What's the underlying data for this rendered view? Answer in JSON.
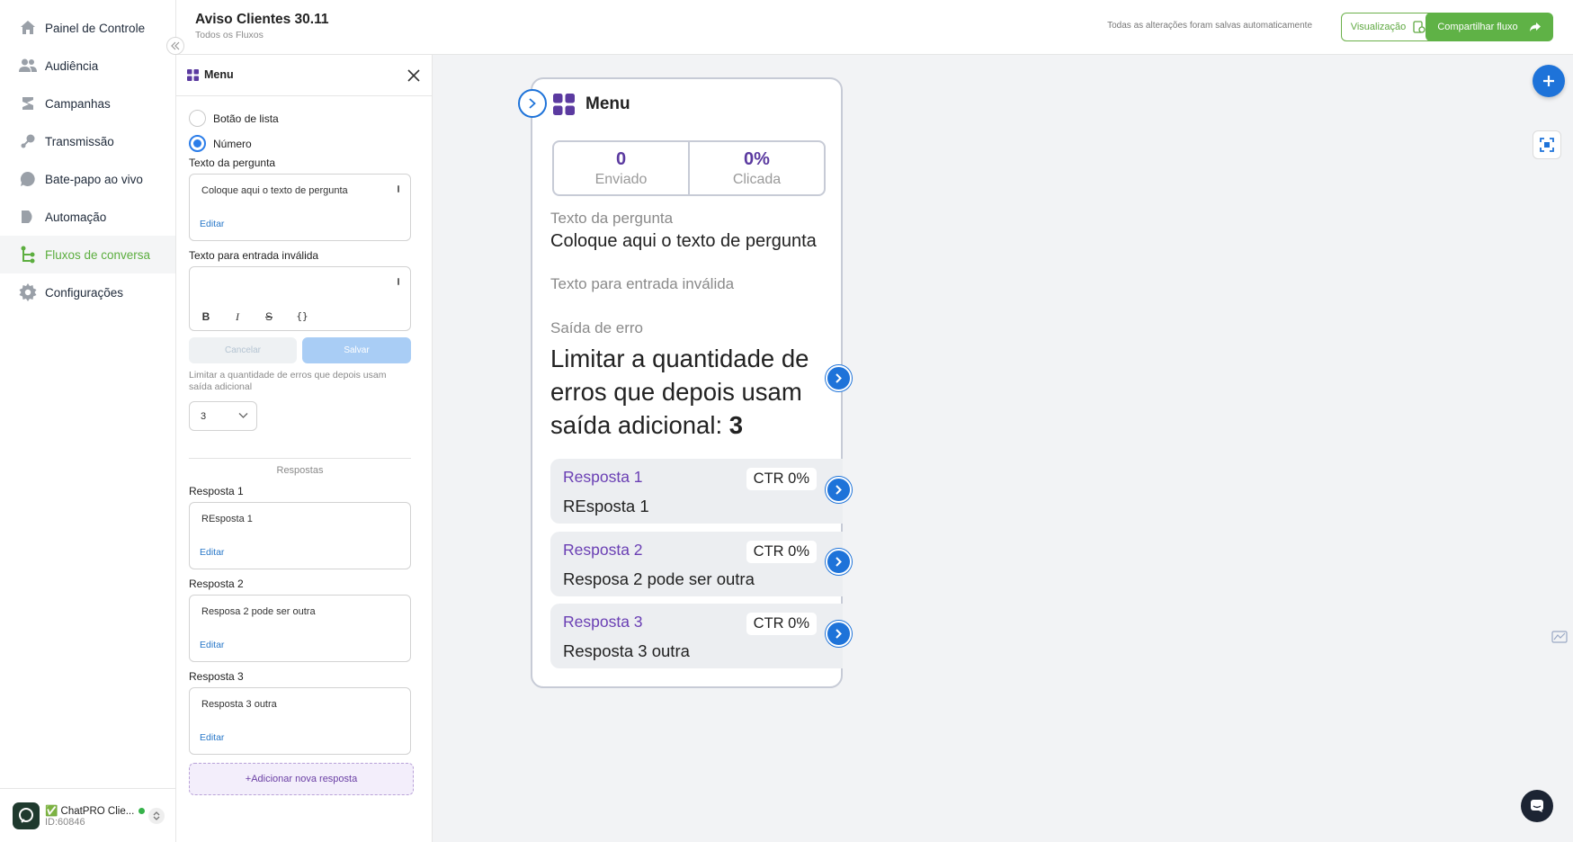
{
  "sidebar": {
    "items": [
      {
        "label": "Painel de Controle",
        "icon": "home-icon"
      },
      {
        "label": "Audiência",
        "icon": "users-icon"
      },
      {
        "label": "Campanhas",
        "icon": "campaign-icon"
      },
      {
        "label": "Transmissão",
        "icon": "broadcast-icon"
      },
      {
        "label": "Bate-papo ao vivo",
        "icon": "chat-bubble-icon"
      },
      {
        "label": "Automação",
        "icon": "automation-icon"
      },
      {
        "label": "Fluxos de conversa",
        "icon": "flow-icon"
      },
      {
        "label": "Configurações",
        "icon": "gear-icon"
      }
    ],
    "active_index": 6,
    "account": {
      "name": "✅ ChatPRO Clie...",
      "id": "ID:60846"
    }
  },
  "header": {
    "title": "Aviso Clientes 30.11",
    "breadcrumb": "Todos os Fluxos",
    "autosave": "Todas as alterações foram salvas automaticamente",
    "preview_label": "Visualização",
    "share_label": "Compartilhar fluxo"
  },
  "editor": {
    "title": "Menu",
    "radio_list_label": "Botão de lista",
    "radio_number_label": "Número",
    "question_label": "Texto da pergunta",
    "question_text": "Coloque aqui o texto de pergunta",
    "edit_label": "Editar",
    "invalid_label": "Texto para entrada inválida",
    "format_buttons": [
      "B",
      "I",
      "S",
      "{}"
    ],
    "cancel_label": "Cancelar",
    "save_label": "Salvar",
    "error_help": "Limitar a quantidade de erros que depois usam saída adicional",
    "error_limit": "3",
    "answers_heading": "Respostas",
    "answers": [
      {
        "label": "Resposta 1",
        "text": "REsposta 1"
      },
      {
        "label": "Resposta 2",
        "text": "Resposa 2 pode ser outra"
      },
      {
        "label": "Resposta 3",
        "text": "Resposta 3 outra"
      }
    ],
    "add_answer_label": "+Adicionar nova resposta"
  },
  "node": {
    "title": "Menu",
    "stats": [
      {
        "value": "0",
        "label": "Enviado"
      },
      {
        "value": "0%",
        "label": "Clicada"
      }
    ],
    "question_label": "Texto da pergunta",
    "question_text": "Coloque aqui o texto de pergunta",
    "invalid_label": "Texto para entrada inválida",
    "error_label": "Saída de erro",
    "error_text": "Limitar a quantidade de erros que depois usam saída adicional:",
    "error_value": "3",
    "responses": [
      {
        "name": "Resposta 1",
        "text": "REsposta 1",
        "ctr": "CTR 0%"
      },
      {
        "name": "Resposta 2",
        "text": "Resposa 2 pode ser outra",
        "ctr": "CTR 0%"
      },
      {
        "name": "Resposta 3",
        "text": "Resposta 3 outra",
        "ctr": "CTR 0%"
      }
    ]
  },
  "colors": {
    "brand_green": "#5fb246",
    "accent_blue": "#1e73d9",
    "purple": "#6a3fb4"
  }
}
